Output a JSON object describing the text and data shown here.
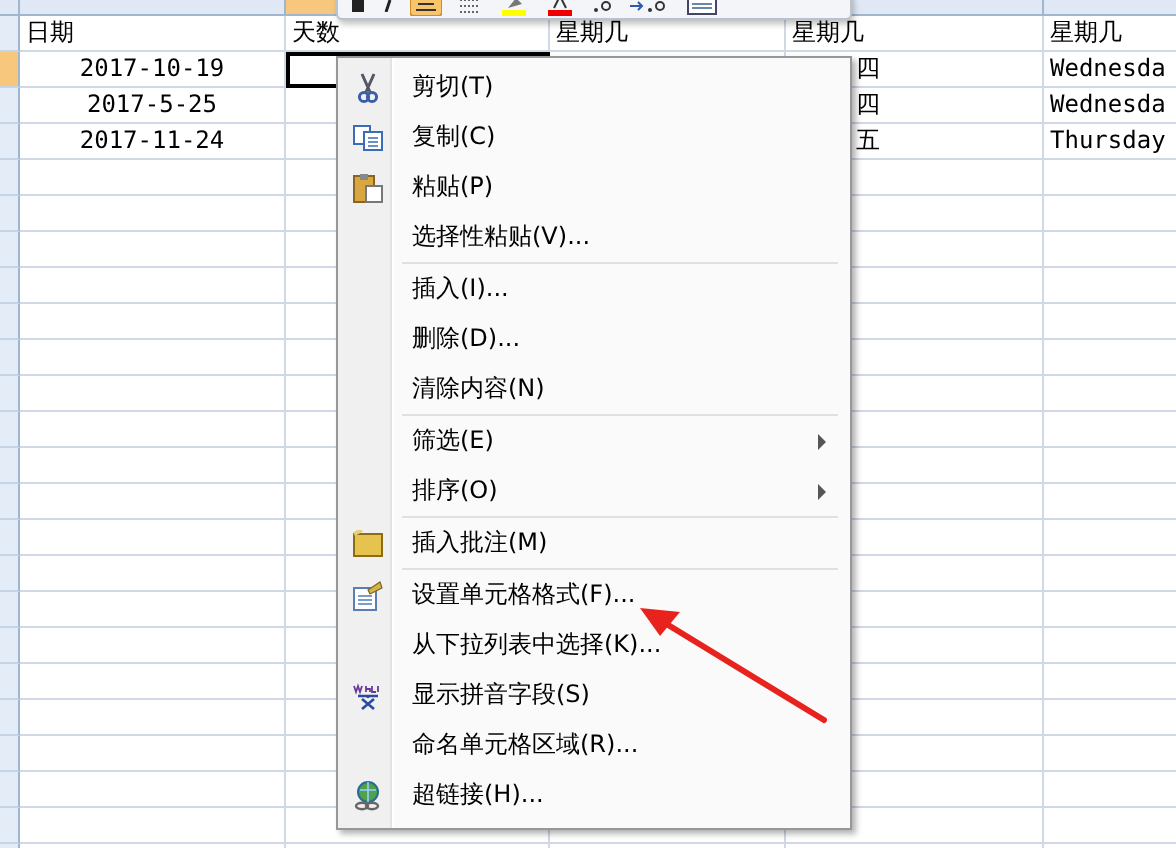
{
  "sheet": {
    "rows": [
      {
        "selected": false,
        "cells": [
          {
            "text": "日期",
            "centered": false
          },
          {
            "text": "天数",
            "centered": false
          },
          {
            "text": "星期几",
            "centered": false
          },
          {
            "text": "星期几",
            "centered": false
          },
          {
            "text": "星期几",
            "centered": false
          }
        ]
      },
      {
        "selected": true,
        "cells": [
          {
            "text": "2017-10-19",
            "centered": true
          },
          {
            "text": "",
            "selected": true
          },
          {},
          {
            "text": "四",
            "centered": false
          },
          {
            "text": "Wednesda",
            "centered": false
          }
        ]
      },
      {
        "selected": false,
        "cells": [
          {
            "text": "2017-5-25",
            "centered": true
          },
          {},
          {},
          {
            "text": "四",
            "centered": false
          },
          {
            "text": "Wednesda",
            "centered": false
          }
        ]
      },
      {
        "selected": false,
        "cells": [
          {
            "text": "2017-11-24",
            "centered": true
          },
          {},
          {},
          {
            "text": "五",
            "centered": false
          },
          {
            "text": "Thursday",
            "centered": false
          }
        ]
      }
    ]
  },
  "context_menu": {
    "sections": [
      [
        {
          "label": "剪切(T)",
          "submenu": false
        },
        {
          "label": "复制(C)",
          "submenu": false
        },
        {
          "label": "粘贴(P)",
          "submenu": false
        },
        {
          "label": "选择性粘贴(V)...",
          "submenu": false
        }
      ],
      [
        {
          "label": "插入(I)...",
          "submenu": false
        },
        {
          "label": "删除(D)...",
          "submenu": false
        },
        {
          "label": "清除内容(N)",
          "submenu": false
        }
      ],
      [
        {
          "label": "筛选(E)",
          "submenu": true
        },
        {
          "label": "排序(O)",
          "submenu": true
        }
      ],
      [
        {
          "label": "插入批注(M)",
          "submenu": false
        }
      ],
      [
        {
          "label": "设置单元格格式(F)...",
          "submenu": false
        },
        {
          "label": "从下拉列表中选择(K)...",
          "submenu": false
        },
        {
          "label": "显示拼音字段(S)",
          "submenu": false
        },
        {
          "label": "命名单元格区域(R)...",
          "submenu": false
        },
        {
          "label": "超链接(H)...",
          "submenu": false
        }
      ]
    ]
  }
}
